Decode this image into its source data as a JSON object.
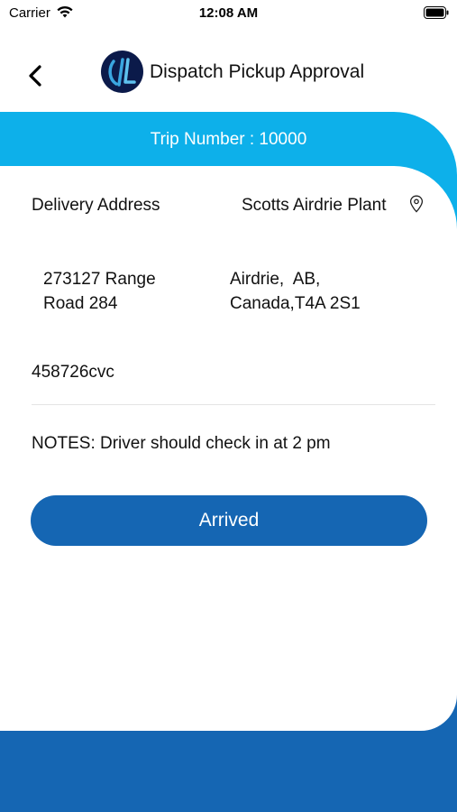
{
  "status_bar": {
    "carrier": "Carrier",
    "time": "12:08 AM",
    "icons": [
      "wifi-icon",
      "battery-icon"
    ]
  },
  "nav": {
    "title": "Dispatch Pickup Approval",
    "back_icon": "chevron-left-icon",
    "logo_icon": "app-logo"
  },
  "trip": {
    "label": "Trip Number : 10000"
  },
  "delivery": {
    "label": "Delivery Address",
    "location_name": "Scotts Airdrie Plant",
    "location_icon": "map-pin-icon",
    "address_line1_a": "273127 Range",
    "address_line1_b": "Road 284",
    "address_line2_a": "Airdrie,  AB,",
    "address_line2_b": "Canada,T4A 2S1"
  },
  "reference": "458726cvc",
  "notes": "NOTES: Driver should check in at 2 pm",
  "actions": {
    "arrived_label": "Arrived"
  },
  "colors": {
    "header_cyan": "#0db0ea",
    "primary_blue": "#1566b3",
    "logo_navy": "#0b1a4a"
  }
}
